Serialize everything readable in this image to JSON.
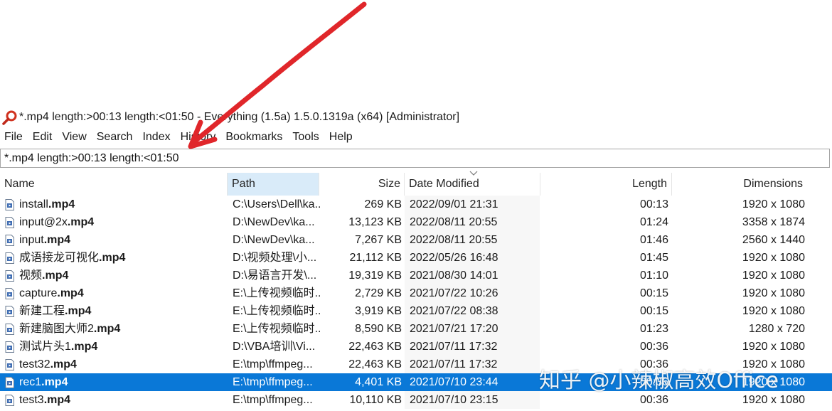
{
  "window": {
    "title": "*.mp4 length:>00:13  length:<01:50  - Everything (1.5a) 1.5.0.1319a (x64) [Administrator]"
  },
  "menu": [
    "File",
    "Edit",
    "View",
    "Search",
    "Index",
    "History",
    "Bookmarks",
    "Tools",
    "Help"
  ],
  "search": {
    "value": "*.mp4 length:>00:13  length:<01:50"
  },
  "columns": {
    "name": "Name",
    "path": "Path",
    "size": "Size",
    "date": "Date Modified",
    "length": "Length",
    "dimensions": "Dimensions"
  },
  "rows": [
    {
      "base": "install",
      "ext": ".mp4",
      "path": "C:\\Users\\Dell\\ka...",
      "size": "269 KB",
      "date": "2022/09/01 21:31",
      "length": "00:13",
      "dims": "1920 x 1080",
      "selected": false
    },
    {
      "base": "input@2x",
      "ext": ".mp4",
      "path": "D:\\NewDev\\ka...",
      "size": "13,123 KB",
      "date": "2022/08/11 20:55",
      "length": "01:24",
      "dims": "3358 x 1874",
      "selected": false
    },
    {
      "base": "input",
      "ext": ".mp4",
      "path": "D:\\NewDev\\ka...",
      "size": "7,267 KB",
      "date": "2022/08/11 20:55",
      "length": "01:46",
      "dims": "2560 x 1440",
      "selected": false
    },
    {
      "base": "成语接龙可视化",
      "ext": ".mp4",
      "path": "D:\\视频处理\\小...",
      "size": "21,112 KB",
      "date": "2022/05/26 16:48",
      "length": "01:45",
      "dims": "1920 x 1080",
      "selected": false
    },
    {
      "base": "视频",
      "ext": ".mp4",
      "path": "D:\\易语言开发\\...",
      "size": "19,319 KB",
      "date": "2021/08/30 14:01",
      "length": "01:10",
      "dims": "1920 x 1080",
      "selected": false
    },
    {
      "base": "capture",
      "ext": ".mp4",
      "path": "E:\\上传视频临时...",
      "size": "2,729 KB",
      "date": "2021/07/22 10:26",
      "length": "00:15",
      "dims": "1920 x 1080",
      "selected": false
    },
    {
      "base": "新建工程",
      "ext": ".mp4",
      "path": "E:\\上传视频临时...",
      "size": "3,919 KB",
      "date": "2021/07/22 08:38",
      "length": "00:15",
      "dims": "1920 x 1080",
      "selected": false
    },
    {
      "base": "新建脑图大师2",
      "ext": ".mp4",
      "path": "E:\\上传视频临时...",
      "size": "8,590 KB",
      "date": "2021/07/21 17:20",
      "length": "01:23",
      "dims": "1280 x 720",
      "selected": false
    },
    {
      "base": "测试片头1",
      "ext": ".mp4",
      "path": "D:\\VBA培训\\Vi...",
      "size": "22,463 KB",
      "date": "2021/07/11 17:32",
      "length": "00:36",
      "dims": "1920 x 1080",
      "selected": false
    },
    {
      "base": "test32",
      "ext": ".mp4",
      "path": "E:\\tmp\\ffmpeg...",
      "size": "22,463 KB",
      "date": "2021/07/11 17:32",
      "length": "00:36",
      "dims": "1920 x 1080",
      "selected": false
    },
    {
      "base": "rec1",
      "ext": ".mp4",
      "path": "E:\\tmp\\ffmpeg...",
      "size": "4,401 KB",
      "date": "2021/07/10 23:44",
      "length": "00:36",
      "dims": "1920 x 1080",
      "selected": true
    },
    {
      "base": "test3",
      "ext": ".mp4",
      "path": "E:\\tmp\\ffmpeg...",
      "size": "10,110 KB",
      "date": "2021/07/10 23:15",
      "length": "00:36",
      "dims": "1920 x 1080",
      "selected": false
    }
  ],
  "watermark": "知乎 @小辣椒高效Office",
  "colors": {
    "selection": "#0a78d7",
    "arrow": "#e0262a",
    "sorted_column_bg": "#d9ebf9"
  },
  "icons": {
    "app": "magnifier-icon",
    "file": "video-file-icon"
  }
}
